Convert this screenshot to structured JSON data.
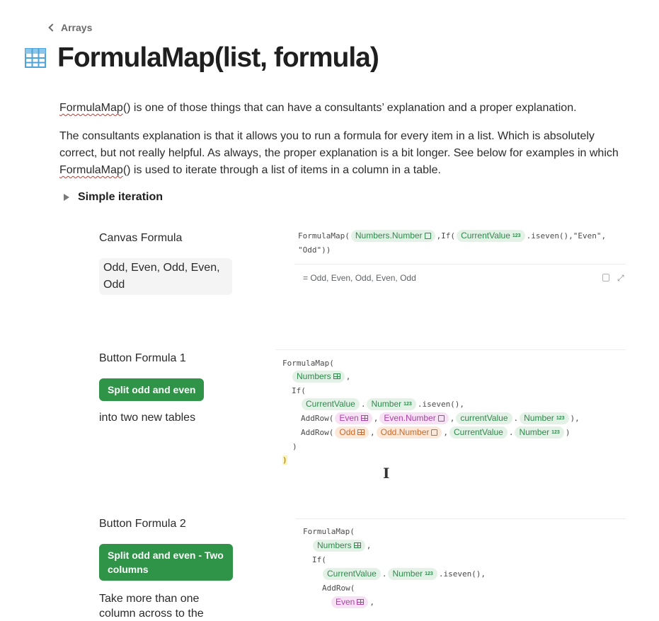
{
  "breadcrumb": {
    "label": "Arrays"
  },
  "page": {
    "title": "FormulaMap(list, formula)",
    "icon": "table-icon"
  },
  "intro": {
    "p1_link": "FormulaMap",
    "p1_rest": "() is one of those things that can have a consultants’ explanation and a proper explanation.",
    "p2_start": "The consultants explanation is that it allows you to run a formula for every item in a list. Which is absolutely correct, but not really helpful. As always, the proper explanation is a bit longer. See below for examples in which ",
    "p2_link": "FormulaMap",
    "p2_end": "() is used to iterate through a list of items in a column in a table."
  },
  "toggle": {
    "label": "Simple iteration"
  },
  "section1": {
    "label": "Canvas Formula",
    "result": "Odd, Even, Odd, Even, Odd",
    "formula": {
      "fn": "FormulaMap(",
      "chip_numbers_number": "Numbers.Number",
      "mid": ",If(",
      "chip_current_value": "CurrentValue",
      "tail": ".iseven(),\"Even\",",
      "line2": "\"Odd\"))",
      "eq_result": "= Odd, Even, Odd, Even, Odd"
    }
  },
  "section2": {
    "label": "Button Formula 1",
    "button": "Split odd and even",
    "caption": "into two new tables",
    "formula": {
      "l1": "FormulaMap(",
      "chip_numbers": "Numbers",
      "l3": "If(",
      "chip_current_value": "CurrentValue",
      "chip_number": "Number",
      "iseven": ".iseven(),",
      "addrow": "AddRow(",
      "chip_even": "Even",
      "chip_even_number": "Even.Number",
      "chip_current_value_lc": "currentValue",
      "chip_odd": "Odd",
      "chip_odd_number": "Odd.Number",
      "close1": ")",
      "close2": ")"
    }
  },
  "section3": {
    "label": "Button Formula 2",
    "button": "Split odd and even - Two columns",
    "caption": "Take more than one column across to the",
    "formula": {
      "l1": "FormulaMap(",
      "chip_numbers": "Numbers",
      "l3": "If(",
      "chip_current_value": "CurrentValue",
      "chip_number": "Number",
      "iseven": ".iseven(),",
      "addrow": "AddRow(",
      "chip_even": "Even"
    }
  },
  "colors": {
    "accent_button": "#2f9348",
    "chip_green": "#e3f1e6",
    "chip_pink": "#f6e2f4",
    "chip_orange": "#fbe8d9"
  }
}
